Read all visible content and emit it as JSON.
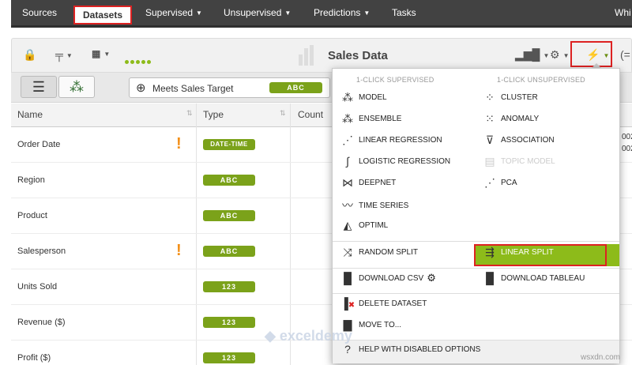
{
  "nav": {
    "sources": "Sources",
    "datasets": "Datasets",
    "supervised": "Supervised",
    "unsupervised": "Unsupervised",
    "predictions": "Predictions",
    "tasks": "Tasks",
    "user": "Whi"
  },
  "toolbar": {
    "title": "Sales Data"
  },
  "objective": {
    "label": "Meets Sales Target",
    "type": "ABC"
  },
  "table": {
    "headers": [
      "Name",
      "Type",
      "Count"
    ],
    "rows": [
      {
        "name": "Order Date",
        "type": "DATE-TIME",
        "warn": true
      },
      {
        "name": "Region",
        "type": "ABC",
        "warn": false
      },
      {
        "name": "Product",
        "type": "ABC",
        "warn": false
      },
      {
        "name": "Salesperson",
        "type": "ABC",
        "warn": true
      },
      {
        "name": "Units Sold",
        "type": "123",
        "warn": false
      },
      {
        "name": "Revenue ($)",
        "type": "123",
        "warn": false
      },
      {
        "name": "Profit ($)",
        "type": "123",
        "warn": false
      }
    ],
    "right_fragment": [
      "002",
      "002"
    ]
  },
  "menu": {
    "supervised_head": "1-CLICK SUPERVISED",
    "unsupervised_head": "1-CLICK UNSUPERVISED",
    "model": "MODEL",
    "ensemble": "ENSEMBLE",
    "linear_regression": "LINEAR REGRESSION",
    "logistic_regression": "LOGISTIC REGRESSION",
    "deepnet": "DEEPNET",
    "time_series": "TIME SERIES",
    "optiml": "OPTIML",
    "cluster": "CLUSTER",
    "anomaly": "ANOMALY",
    "association": "ASSOCIATION",
    "topic_model": "TOPIC MODEL",
    "pca": "PCA",
    "random_split": "RANDOM SPLIT",
    "linear_split": "LINEAR SPLIT",
    "download_csv": "DOWNLOAD CSV",
    "download_tableau": "DOWNLOAD TABLEAU",
    "delete_dataset": "DELETE DATASET",
    "move_to": "MOVE TO...",
    "help": "HELP WITH DISABLED OPTIONS"
  },
  "colors": {
    "accent": "#8dbb1a",
    "pill": "#7ba21a",
    "nav_bg": "#424242",
    "annotation": "#dd2222",
    "warning": "#f39019"
  },
  "watermark": "exceldemy",
  "credit": "wsxdn.com"
}
